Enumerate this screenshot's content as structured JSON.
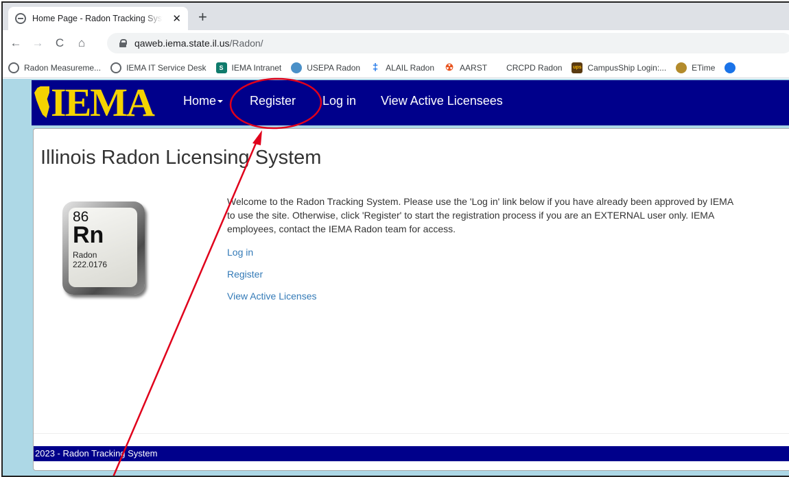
{
  "browser": {
    "tab_title": "Home Page - Radon Tracking System",
    "tab_close": "✕",
    "new_tab": "+",
    "back": "←",
    "forward": "→",
    "reload": "C",
    "home": "⌂",
    "url_host": "qaweb.iema.state.il.us",
    "url_path": "/Radon/"
  },
  "bookmarks": [
    {
      "label": "Radon Measureme...",
      "icon": "globe-icon"
    },
    {
      "label": "IEMA IT Service Desk",
      "icon": "globe-icon"
    },
    {
      "label": "IEMA Intranet",
      "icon": "sharepoint-icon"
    },
    {
      "label": "USEPA Radon",
      "icon": "epa-icon"
    },
    {
      "label": "ALAIL Radon",
      "icon": "cross-icon"
    },
    {
      "label": "AARST",
      "icon": "radiation-icon"
    },
    {
      "label": "CRCPD Radon",
      "icon": "none"
    },
    {
      "label": "CampusShip Login:...",
      "icon": "ups-icon"
    },
    {
      "label": "ETime",
      "icon": "seal-icon"
    }
  ],
  "nav": {
    "logo": "IEMA",
    "home": "Home",
    "register": "Register",
    "login": "Log in",
    "licensees": "View Active Licensees"
  },
  "main": {
    "title": "Illinois Radon Licensing System",
    "element": {
      "number": "86",
      "symbol": "Rn",
      "name": "Radon",
      "mass": "222.0176"
    },
    "welcome": "Welcome to the Radon Tracking System. Please use the 'Log in' link below if you have already been approved by IEMA to use the site. Otherwise, click 'Register' to start the registration process if you are an EXTERNAL user only. IEMA employees, contact the IEMA Radon team for access.",
    "links": {
      "login": "Log in",
      "register": "Register",
      "licenses": "View Active Licenses"
    }
  },
  "footer": {
    "text": "2023 - Radon Tracking System"
  },
  "annotation": {
    "color": "#e0001b"
  }
}
